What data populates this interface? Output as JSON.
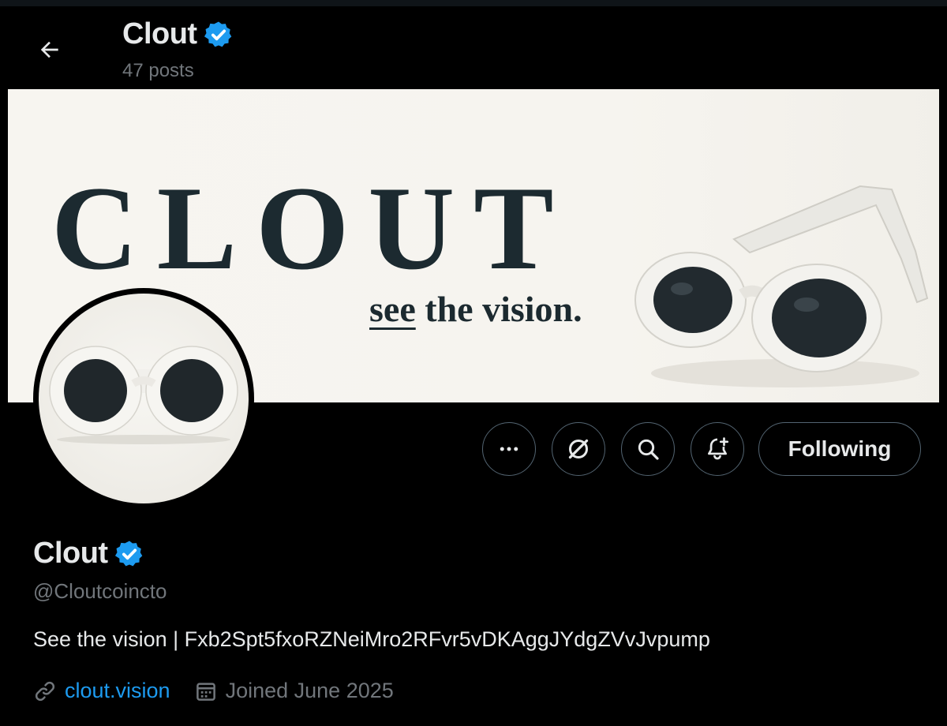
{
  "header": {
    "name": "Clout",
    "posts": "47 posts"
  },
  "banner": {
    "word": "CLOUT",
    "tagline_emphasis": "see",
    "tagline_rest": " the vision."
  },
  "actions": {
    "following_label": "Following",
    "icons": [
      "more-icon",
      "grok-icon",
      "search-icon",
      "notification-bell-icon"
    ]
  },
  "profile": {
    "name": "Clout",
    "handle": "@Cloutcoincto",
    "bio": "See the vision | Fxb2Spt5fxoRZNeiMro2RFvr5vDKAggJYdgZVvJvpump",
    "website": "clout.vision",
    "joined": "Joined June 2025"
  },
  "colors": {
    "verified": "#1d9bf0",
    "link": "#1d9bf0",
    "muted": "#71767b",
    "banner_text": "#1c2a30"
  }
}
